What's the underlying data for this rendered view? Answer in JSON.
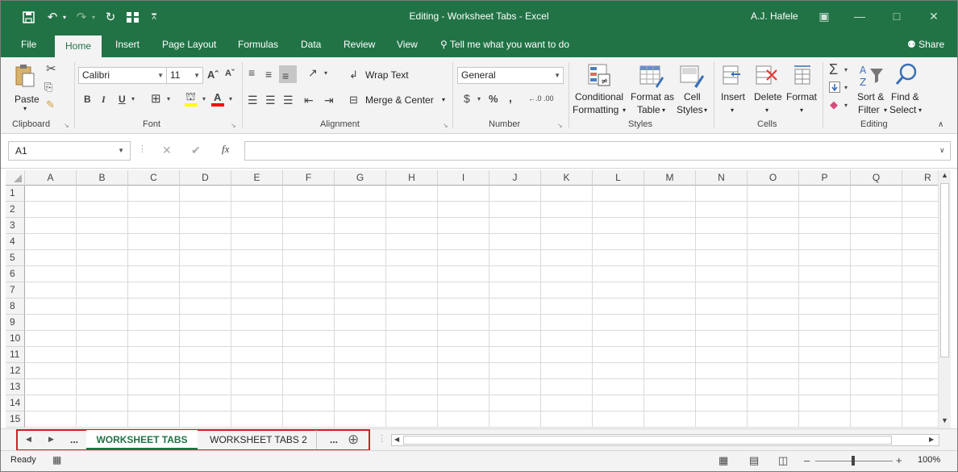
{
  "window": {
    "title": "Editing - Worksheet Tabs  -  Excel",
    "user": "A.J. Hafele",
    "qat_icons": [
      "save-icon",
      "undo-icon",
      "redo-icon",
      "refresh-icon",
      "view-icon",
      "customize-icon"
    ]
  },
  "ribbon_tabs": [
    {
      "label": "File"
    },
    {
      "label": "Home",
      "active": true
    },
    {
      "label": "Insert"
    },
    {
      "label": "Page Layout"
    },
    {
      "label": "Formulas"
    },
    {
      "label": "Data"
    },
    {
      "label": "Review"
    },
    {
      "label": "View"
    }
  ],
  "tell_me": "Tell me what you want to do",
  "share": "Share",
  "clipboard": {
    "paste": "Paste",
    "label": "Clipboard"
  },
  "font": {
    "name": "Calibri",
    "size": "11",
    "label": "Font",
    "bold": "B",
    "italic": "I",
    "underline": "U",
    "grow": "Aˆ",
    "shrink": "Aˇ",
    "font_color_letter": "A",
    "highlight_color": "#ffff00",
    "font_color": "#ff0000"
  },
  "alignment": {
    "wrap": "Wrap Text",
    "merge": "Merge & Center",
    "label": "Alignment"
  },
  "number": {
    "format": "General",
    "label": "Number",
    "currency": "$",
    "percent": "%",
    "comma": ",",
    "inc_dec": "←.0 .00",
    "dec_dec": ".00 →.0"
  },
  "styles": {
    "cond_l1": "Conditional",
    "cond_l2": "Formatting",
    "table_l1": "Format as",
    "table_l2": "Table",
    "cell_l1": "Cell",
    "cell_l2": "Styles",
    "label": "Styles"
  },
  "cells": {
    "insert": "Insert",
    "delete": "Delete",
    "format": "Format",
    "label": "Cells"
  },
  "editing": {
    "sort_l1": "Sort &",
    "sort_l2": "Filter",
    "find_l1": "Find &",
    "find_l2": "Select",
    "label": "Editing"
  },
  "formula_bar": {
    "name_box": "A1",
    "fx": "fx",
    "value": ""
  },
  "columns": [
    "A",
    "B",
    "C",
    "D",
    "E",
    "F",
    "G",
    "H",
    "I",
    "J",
    "K",
    "L",
    "M",
    "N",
    "O",
    "P",
    "Q",
    "R"
  ],
  "rows": [
    "1",
    "2",
    "3",
    "4",
    "5",
    "6",
    "7",
    "8",
    "9",
    "10",
    "11",
    "12",
    "13",
    "14",
    "15"
  ],
  "sheet_tabs": {
    "prev": "◀",
    "next": "▶",
    "more_left": "...",
    "active": "WORKSHEET TABS",
    "other": "WORKSHEET TABS 2",
    "more_right": "...",
    "add": "⊕"
  },
  "status": {
    "mode": "Ready",
    "zoom": "100%"
  },
  "colors": {
    "brand": "#217346",
    "highlight_border": "#d31f2a"
  }
}
